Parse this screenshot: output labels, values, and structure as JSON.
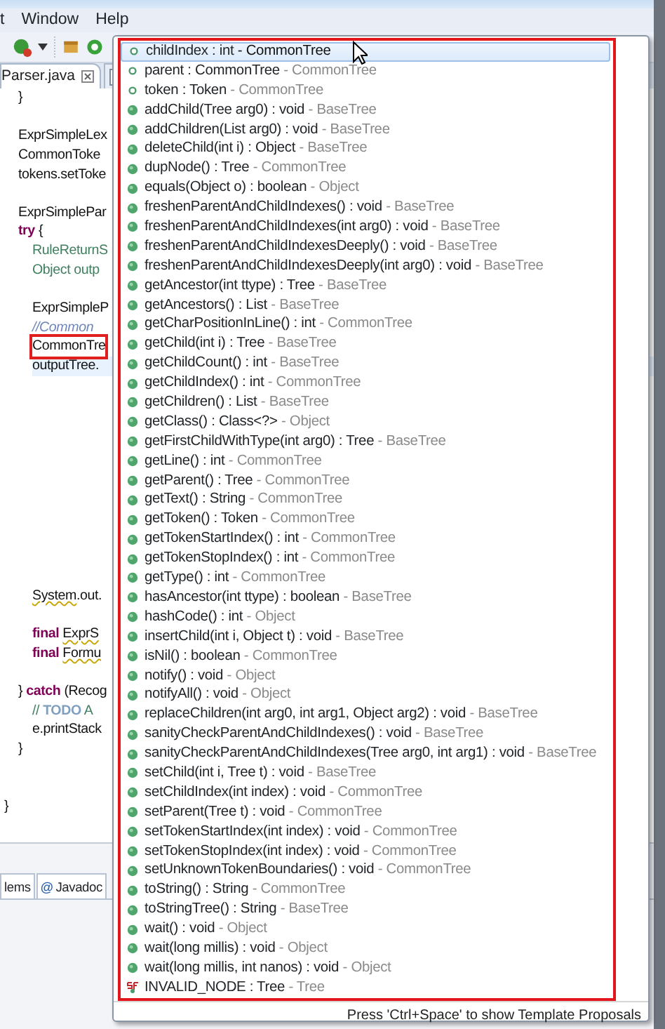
{
  "menu": [
    "t",
    "Window",
    "Help"
  ],
  "editor_tabs": [
    {
      "label": "Parser.java",
      "selected": true
    },
    {
      "selected": false
    }
  ],
  "code": [
    {
      "children": [
        {
          "tokens": [
            {
              "text": "}",
              "kind": "plain"
            }
          ]
        },
        {
          "kind": "blank"
        },
        {
          "tokens": [
            {
              "text": "ExprSimpleLex",
              "kind": "plain"
            }
          ]
        },
        {
          "tokens": [
            {
              "text": "CommonToke",
              "kind": "plain"
            }
          ]
        },
        {
          "tokens": [
            {
              "text": "tokens.setToke",
              "kind": "plain"
            }
          ]
        },
        {
          "kind": "blank"
        },
        {
          "tokens": [
            {
              "text": "ExprSimplePar",
              "kind": "plain"
            }
          ]
        },
        {
          "tokens": [
            {
              "text": "try",
              "kind": "keyword"
            },
            {
              "text": " {",
              "kind": "plain"
            }
          ],
          "children": [
            {
              "tokens": [
                {
                  "text": "RuleReturnS",
                  "kind": "comment"
                }
              ]
            },
            {
              "tokens": [
                {
                  "text": "Object outp",
                  "kind": "comment"
                }
              ]
            },
            {
              "kind": "blank"
            },
            {
              "tokens": [
                {
                  "text": "ExprSimpleP",
                  "kind": "plain"
                }
              ]
            },
            {
              "tokens": [
                {
                  "text": "//Common",
                  "kind": "doc"
                }
              ]
            },
            {
              "tokens": [
                {
                  "text": "CommonTre",
                  "kind": "plain"
                }
              ],
              "boxed": true
            },
            {
              "tokens": [
                {
                  "text": "outputTree.",
                  "kind": "plain"
                }
              ],
              "current": true
            },
            {
              "kind": "blank"
            },
            {
              "kind": "blank"
            },
            {
              "kind": "blank"
            },
            {
              "kind": "blank"
            },
            {
              "kind": "blank"
            },
            {
              "kind": "blank"
            },
            {
              "kind": "blank"
            },
            {
              "kind": "blank"
            },
            {
              "kind": "blank"
            },
            {
              "kind": "blank"
            },
            {
              "kind": "blank"
            },
            {
              "tokens": [
                {
                  "text": "System",
                  "kind": "warning"
                },
                {
                  "text": ".out.",
                  "kind": "plain"
                }
              ]
            },
            {
              "kind": "blank"
            },
            {
              "tokens": [
                {
                  "text": "final ",
                  "kind": "keyword"
                },
                {
                  "text": "ExprS",
                  "kind": "warning"
                }
              ]
            },
            {
              "tokens": [
                {
                  "text": "final ",
                  "kind": "keyword"
                },
                {
                  "text": "Formu",
                  "kind": "warning"
                }
              ]
            },
            {
              "kind": "blank"
            }
          ]
        },
        {
          "tokens": [
            {
              "text": "} ",
              "kind": "plain"
            },
            {
              "text": "catch",
              "kind": "keyword"
            },
            {
              "text": " (Recog",
              "kind": "plain"
            }
          ],
          "children": [
            {
              "tokens": [
                {
                  "text": "// ",
                  "kind": "comment"
                },
                {
                  "text": "TODO",
                  "kind": "task"
                },
                {
                  "text": " A",
                  "kind": "comment"
                }
              ]
            },
            {
              "tokens": [
                {
                  "text": "e.printStack",
                  "kind": "plain"
                }
              ]
            }
          ]
        },
        {
          "tokens": [
            {
              "text": "}",
              "kind": "plain"
            }
          ]
        },
        {
          "kind": "blank"
        },
        {
          "kind": "blank"
        }
      ]
    },
    {
      "tokens": [
        {
          "text": "}",
          "kind": "plain"
        }
      ]
    }
  ],
  "bottom_tabs": [
    {
      "label": "lems"
    },
    {
      "icon": "@",
      "label": "Javadoc"
    }
  ],
  "proposals": [
    {
      "kind": "field",
      "signature": "childIndex : int",
      "owner": "- CommonTree",
      "selected": true
    },
    {
      "kind": "field",
      "signature": "parent : CommonTree",
      "owner": "- CommonTree",
      "selected": false
    },
    {
      "kind": "field",
      "signature": "token : Token",
      "owner": "- CommonTree",
      "selected": false
    },
    {
      "kind": "method",
      "signature": "addChild(Tree arg0) : void",
      "owner": "- BaseTree",
      "selected": false
    },
    {
      "kind": "method",
      "signature": "addChildren(List arg0) : void",
      "owner": "- BaseTree",
      "selected": false
    },
    {
      "kind": "method",
      "signature": "deleteChild(int i) : Object",
      "owner": "- BaseTree",
      "selected": false
    },
    {
      "kind": "method",
      "signature": "dupNode() : Tree",
      "owner": "- CommonTree",
      "selected": false
    },
    {
      "kind": "method",
      "signature": "equals(Object o) : boolean",
      "owner": "- Object",
      "selected": false
    },
    {
      "kind": "method",
      "signature": "freshenParentAndChildIndexes() : void",
      "owner": "- BaseTree",
      "selected": false
    },
    {
      "kind": "method",
      "signature": "freshenParentAndChildIndexes(int arg0) : void",
      "owner": "- BaseTree",
      "selected": false
    },
    {
      "kind": "method",
      "signature": "freshenParentAndChildIndexesDeeply() : void",
      "owner": "- BaseTree",
      "selected": false
    },
    {
      "kind": "method",
      "signature": "freshenParentAndChildIndexesDeeply(int arg0) : void",
      "owner": "- BaseTree",
      "selected": false
    },
    {
      "kind": "method",
      "signature": "getAncestor(int ttype) : Tree",
      "owner": "- BaseTree",
      "selected": false
    },
    {
      "kind": "method",
      "signature": "getAncestors() : List",
      "owner": "- BaseTree",
      "selected": false
    },
    {
      "kind": "method",
      "signature": "getCharPositionInLine() : int",
      "owner": "- CommonTree",
      "selected": false
    },
    {
      "kind": "method",
      "signature": "getChild(int i) : Tree",
      "owner": "- BaseTree",
      "selected": false
    },
    {
      "kind": "method",
      "signature": "getChildCount() : int",
      "owner": "- BaseTree",
      "selected": false
    },
    {
      "kind": "method",
      "signature": "getChildIndex() : int",
      "owner": "- CommonTree",
      "selected": false
    },
    {
      "kind": "method",
      "signature": "getChildren() : List",
      "owner": "- BaseTree",
      "selected": false
    },
    {
      "kind": "method",
      "signature": "getClass() : Class<?>",
      "owner": "- Object",
      "selected": false
    },
    {
      "kind": "method",
      "signature": "getFirstChildWithType(int arg0) : Tree",
      "owner": "- BaseTree",
      "selected": false
    },
    {
      "kind": "method",
      "signature": "getLine() : int",
      "owner": "- CommonTree",
      "selected": false
    },
    {
      "kind": "method",
      "signature": "getParent() : Tree",
      "owner": "- CommonTree",
      "selected": false
    },
    {
      "kind": "method",
      "signature": "getText() : String",
      "owner": "- CommonTree",
      "selected": false
    },
    {
      "kind": "method",
      "signature": "getToken() : Token",
      "owner": "- CommonTree",
      "selected": false
    },
    {
      "kind": "method",
      "signature": "getTokenStartIndex() : int",
      "owner": "- CommonTree",
      "selected": false
    },
    {
      "kind": "method",
      "signature": "getTokenStopIndex() : int",
      "owner": "- CommonTree",
      "selected": false
    },
    {
      "kind": "method",
      "signature": "getType() : int",
      "owner": "- CommonTree",
      "selected": false
    },
    {
      "kind": "method",
      "signature": "hasAncestor(int ttype) : boolean",
      "owner": "- BaseTree",
      "selected": false
    },
    {
      "kind": "method",
      "signature": "hashCode() : int",
      "owner": "- Object",
      "selected": false
    },
    {
      "kind": "method",
      "signature": "insertChild(int i, Object t) : void",
      "owner": "- BaseTree",
      "selected": false
    },
    {
      "kind": "method",
      "signature": "isNil() : boolean",
      "owner": "- CommonTree",
      "selected": false
    },
    {
      "kind": "method",
      "signature": "notify() : void",
      "owner": "- Object",
      "selected": false
    },
    {
      "kind": "method",
      "signature": "notifyAll() : void",
      "owner": "- Object",
      "selected": false
    },
    {
      "kind": "method",
      "signature": "replaceChildren(int arg0, int arg1, Object arg2) : void",
      "owner": "- BaseTree",
      "selected": false
    },
    {
      "kind": "method",
      "signature": "sanityCheckParentAndChildIndexes() : void",
      "owner": "- BaseTree",
      "selected": false
    },
    {
      "kind": "method",
      "signature": "sanityCheckParentAndChildIndexes(Tree arg0, int arg1) : void",
      "owner": "- BaseTree",
      "selected": false
    },
    {
      "kind": "method",
      "signature": "setChild(int i, Tree t) : void",
      "owner": "- BaseTree",
      "selected": false
    },
    {
      "kind": "method",
      "signature": "setChildIndex(int index) : void",
      "owner": "- CommonTree",
      "selected": false
    },
    {
      "kind": "method",
      "signature": "setParent(Tree t) : void",
      "owner": "- CommonTree",
      "selected": false
    },
    {
      "kind": "method",
      "signature": "setTokenStartIndex(int index) : void",
      "owner": "- CommonTree",
      "selected": false
    },
    {
      "kind": "method",
      "signature": "setTokenStopIndex(int index) : void",
      "owner": "- CommonTree",
      "selected": false
    },
    {
      "kind": "method",
      "signature": "setUnknownTokenBoundaries() : void",
      "owner": "- CommonTree",
      "selected": false
    },
    {
      "kind": "method",
      "signature": "toString() : String",
      "owner": "- CommonTree",
      "selected": false
    },
    {
      "kind": "method",
      "signature": "toStringTree() : String",
      "owner": "- BaseTree",
      "selected": false
    },
    {
      "kind": "method",
      "signature": "wait() : void",
      "owner": "- Object",
      "selected": false
    },
    {
      "kind": "method",
      "signature": "wait(long millis) : void",
      "owner": "- Object",
      "selected": false
    },
    {
      "kind": "method",
      "signature": "wait(long millis, int nanos) : void",
      "owner": "- Object",
      "selected": false
    },
    {
      "kind": "constant",
      "signature": "INVALID_NODE : Tree",
      "owner": "- Tree",
      "selected": false
    }
  ],
  "proposals_footer": "Press 'Ctrl+Space' to show Template Proposals"
}
